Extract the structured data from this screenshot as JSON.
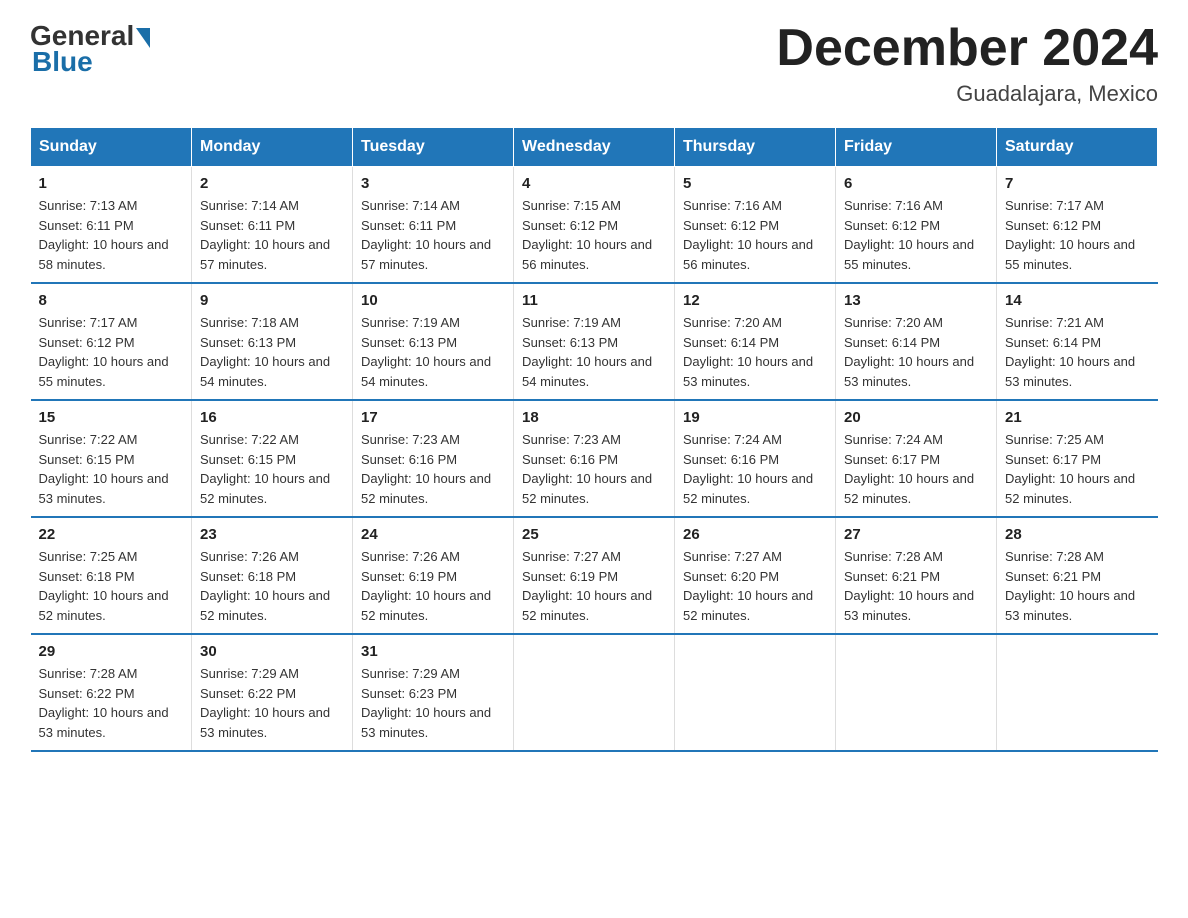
{
  "header": {
    "logo": {
      "general": "General",
      "blue": "Blue"
    },
    "title": "December 2024",
    "location": "Guadalajara, Mexico"
  },
  "weekdays": [
    "Sunday",
    "Monday",
    "Tuesday",
    "Wednesday",
    "Thursday",
    "Friday",
    "Saturday"
  ],
  "weeks": [
    [
      {
        "day": "1",
        "sunrise": "7:13 AM",
        "sunset": "6:11 PM",
        "daylight": "10 hours and 58 minutes."
      },
      {
        "day": "2",
        "sunrise": "7:14 AM",
        "sunset": "6:11 PM",
        "daylight": "10 hours and 57 minutes."
      },
      {
        "day": "3",
        "sunrise": "7:14 AM",
        "sunset": "6:11 PM",
        "daylight": "10 hours and 57 minutes."
      },
      {
        "day": "4",
        "sunrise": "7:15 AM",
        "sunset": "6:12 PM",
        "daylight": "10 hours and 56 minutes."
      },
      {
        "day": "5",
        "sunrise": "7:16 AM",
        "sunset": "6:12 PM",
        "daylight": "10 hours and 56 minutes."
      },
      {
        "day": "6",
        "sunrise": "7:16 AM",
        "sunset": "6:12 PM",
        "daylight": "10 hours and 55 minutes."
      },
      {
        "day": "7",
        "sunrise": "7:17 AM",
        "sunset": "6:12 PM",
        "daylight": "10 hours and 55 minutes."
      }
    ],
    [
      {
        "day": "8",
        "sunrise": "7:17 AM",
        "sunset": "6:12 PM",
        "daylight": "10 hours and 55 minutes."
      },
      {
        "day": "9",
        "sunrise": "7:18 AM",
        "sunset": "6:13 PM",
        "daylight": "10 hours and 54 minutes."
      },
      {
        "day": "10",
        "sunrise": "7:19 AM",
        "sunset": "6:13 PM",
        "daylight": "10 hours and 54 minutes."
      },
      {
        "day": "11",
        "sunrise": "7:19 AM",
        "sunset": "6:13 PM",
        "daylight": "10 hours and 54 minutes."
      },
      {
        "day": "12",
        "sunrise": "7:20 AM",
        "sunset": "6:14 PM",
        "daylight": "10 hours and 53 minutes."
      },
      {
        "day": "13",
        "sunrise": "7:20 AM",
        "sunset": "6:14 PM",
        "daylight": "10 hours and 53 minutes."
      },
      {
        "day": "14",
        "sunrise": "7:21 AM",
        "sunset": "6:14 PM",
        "daylight": "10 hours and 53 minutes."
      }
    ],
    [
      {
        "day": "15",
        "sunrise": "7:22 AM",
        "sunset": "6:15 PM",
        "daylight": "10 hours and 53 minutes."
      },
      {
        "day": "16",
        "sunrise": "7:22 AM",
        "sunset": "6:15 PM",
        "daylight": "10 hours and 52 minutes."
      },
      {
        "day": "17",
        "sunrise": "7:23 AM",
        "sunset": "6:16 PM",
        "daylight": "10 hours and 52 minutes."
      },
      {
        "day": "18",
        "sunrise": "7:23 AM",
        "sunset": "6:16 PM",
        "daylight": "10 hours and 52 minutes."
      },
      {
        "day": "19",
        "sunrise": "7:24 AM",
        "sunset": "6:16 PM",
        "daylight": "10 hours and 52 minutes."
      },
      {
        "day": "20",
        "sunrise": "7:24 AM",
        "sunset": "6:17 PM",
        "daylight": "10 hours and 52 minutes."
      },
      {
        "day": "21",
        "sunrise": "7:25 AM",
        "sunset": "6:17 PM",
        "daylight": "10 hours and 52 minutes."
      }
    ],
    [
      {
        "day": "22",
        "sunrise": "7:25 AM",
        "sunset": "6:18 PM",
        "daylight": "10 hours and 52 minutes."
      },
      {
        "day": "23",
        "sunrise": "7:26 AM",
        "sunset": "6:18 PM",
        "daylight": "10 hours and 52 minutes."
      },
      {
        "day": "24",
        "sunrise": "7:26 AM",
        "sunset": "6:19 PM",
        "daylight": "10 hours and 52 minutes."
      },
      {
        "day": "25",
        "sunrise": "7:27 AM",
        "sunset": "6:19 PM",
        "daylight": "10 hours and 52 minutes."
      },
      {
        "day": "26",
        "sunrise": "7:27 AM",
        "sunset": "6:20 PM",
        "daylight": "10 hours and 52 minutes."
      },
      {
        "day": "27",
        "sunrise": "7:28 AM",
        "sunset": "6:21 PM",
        "daylight": "10 hours and 53 minutes."
      },
      {
        "day": "28",
        "sunrise": "7:28 AM",
        "sunset": "6:21 PM",
        "daylight": "10 hours and 53 minutes."
      }
    ],
    [
      {
        "day": "29",
        "sunrise": "7:28 AM",
        "sunset": "6:22 PM",
        "daylight": "10 hours and 53 minutes."
      },
      {
        "day": "30",
        "sunrise": "7:29 AM",
        "sunset": "6:22 PM",
        "daylight": "10 hours and 53 minutes."
      },
      {
        "day": "31",
        "sunrise": "7:29 AM",
        "sunset": "6:23 PM",
        "daylight": "10 hours and 53 minutes."
      },
      null,
      null,
      null,
      null
    ]
  ]
}
